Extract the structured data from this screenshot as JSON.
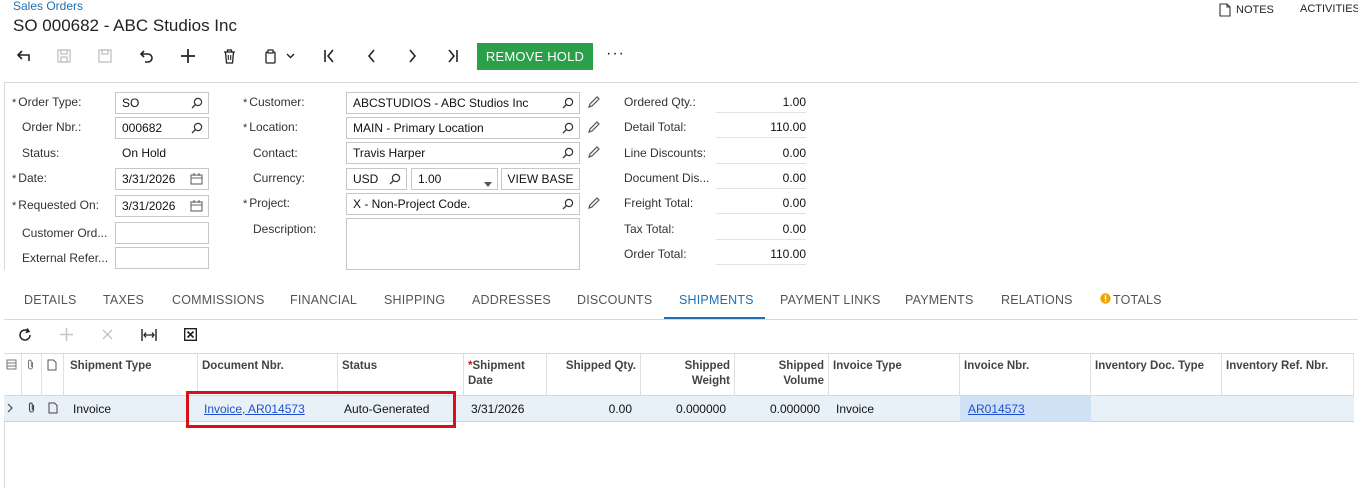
{
  "header": {
    "breadcrumb": "Sales Orders",
    "title": "SO 000682 - ABC Studios Inc",
    "notes_label": "NOTES",
    "activities_label": "ACTIVITIES"
  },
  "toolbar": {
    "remove_hold_label": "REMOVE HOLD",
    "more_label": "···",
    "accent_color": "#2aa04a"
  },
  "form": {
    "order_type": {
      "label": "Order Type:",
      "value": "SO"
    },
    "order_nbr": {
      "label": "Order Nbr.:",
      "value": "000682"
    },
    "status": {
      "label": "Status:",
      "value": "On Hold"
    },
    "date": {
      "label": "Date:",
      "value": "3/31/2026"
    },
    "requested_on": {
      "label": "Requested On:",
      "value": "3/31/2026"
    },
    "customer_ord": {
      "label": "Customer Ord...",
      "value": ""
    },
    "external_ref": {
      "label": "External Refer...",
      "value": ""
    },
    "customer": {
      "label": "Customer:",
      "value": "ABCSTUDIOS - ABC Studios Inc"
    },
    "location": {
      "label": "Location:",
      "value": "MAIN - Primary Location"
    },
    "contact": {
      "label": "Contact:",
      "value": "Travis Harper"
    },
    "currency": {
      "label": "Currency:",
      "value": "USD",
      "rate": "1.00",
      "view_base_label": "VIEW BASE"
    },
    "project": {
      "label": "Project:",
      "value": "X - Non-Project Code."
    },
    "description": {
      "label": "Description:",
      "value": ""
    }
  },
  "totals": [
    {
      "label": "Ordered Qty.:",
      "value": "1.00"
    },
    {
      "label": "Detail Total:",
      "value": "110.00"
    },
    {
      "label": "Line Discounts:",
      "value": "0.00"
    },
    {
      "label": "Document Dis...",
      "value": "0.00"
    },
    {
      "label": "Freight Total:",
      "value": "0.00"
    },
    {
      "label": "Tax Total:",
      "value": "0.00"
    },
    {
      "label": "Order Total:",
      "value": "110.00"
    }
  ],
  "tabs": [
    {
      "label": "DETAILS"
    },
    {
      "label": "TAXES"
    },
    {
      "label": "COMMISSIONS"
    },
    {
      "label": "FINANCIAL"
    },
    {
      "label": "SHIPPING"
    },
    {
      "label": "ADDRESSES"
    },
    {
      "label": "DISCOUNTS"
    },
    {
      "label": "SHIPMENTS",
      "active": true
    },
    {
      "label": "PAYMENT LINKS"
    },
    {
      "label": "PAYMENTS"
    },
    {
      "label": "RELATIONS"
    },
    {
      "label": "TOTALS",
      "warning": true
    }
  ],
  "grid": {
    "columns": [
      {
        "label": "Shipment Type"
      },
      {
        "label": "Document Nbr."
      },
      {
        "label": "Status"
      },
      {
        "label": "Shipment Date",
        "required": true
      },
      {
        "label": "Shipped Qty."
      },
      {
        "label": "Shipped Weight"
      },
      {
        "label": "Shipped Volume"
      },
      {
        "label": "Invoice Type"
      },
      {
        "label": "Invoice Nbr."
      },
      {
        "label": "Inventory Doc. Type"
      },
      {
        "label": "Inventory Ref. Nbr."
      }
    ],
    "rows": [
      {
        "shipment_type": "Invoice",
        "document_nbr": "Invoice, AR014573",
        "status": "Auto-Generated",
        "shipment_date": "3/31/2026",
        "shipped_qty": "0.00",
        "shipped_weight": "0.000000",
        "shipped_volume": "0.000000",
        "invoice_type": "Invoice",
        "invoice_nbr": "AR014573",
        "inventory_doc_type": "",
        "inventory_ref_nbr": ""
      }
    ],
    "highlight_color": "#d6111a"
  }
}
